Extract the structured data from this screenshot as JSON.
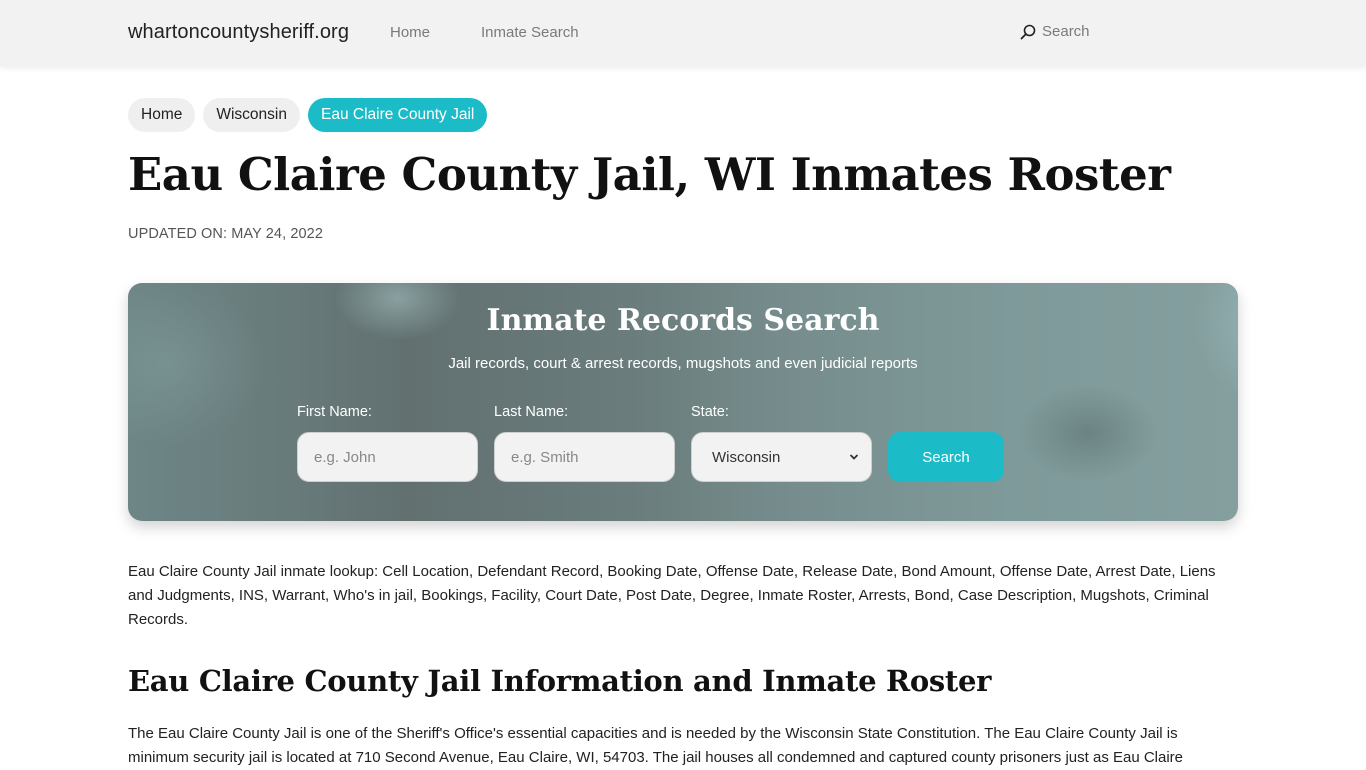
{
  "navbar": {
    "brand": "whartoncountysheriff.org",
    "links": [
      {
        "label": "Home"
      },
      {
        "label": "Inmate Search"
      }
    ],
    "search_label": "Search",
    "search_icon": "search-icon"
  },
  "breadcrumb": [
    {
      "label": "Home",
      "active": false
    },
    {
      "label": "Wisconsin",
      "active": false
    },
    {
      "label": "Eau Claire County Jail",
      "active": true
    }
  ],
  "page": {
    "title": "Eau Claire County Jail, WI Inmates Roster",
    "updated": "UPDATED ON: MAY 24, 2022"
  },
  "search_card": {
    "title": "Inmate Records Search",
    "subtitle": "Jail records, court & arrest records, mugshots and even judicial reports",
    "first_name": {
      "label": "First Name:",
      "placeholder": "e.g. John",
      "value": ""
    },
    "last_name": {
      "label": "Last Name:",
      "placeholder": "e.g. Smith",
      "value": ""
    },
    "state": {
      "label": "State:",
      "selected": "Wisconsin"
    },
    "button_label": "Search"
  },
  "content": {
    "intro": "Eau Claire County Jail inmate lookup: Cell Location, Defendant Record, Booking Date, Offense Date, Release Date, Bond Amount, Offense Date, Arrest Date, Liens and Judgments, INS, Warrant, Who's in jail, Bookings, Facility, Court Date, Post Date, Degree, Inmate Roster, Arrests, Bond, Case Description, Mugshots, Criminal Records.",
    "section_title": "Eau Claire County Jail Information and Inmate Roster",
    "paragraph": "The Eau Claire County Jail is one of the Sheriff's Office's essential capacities and is needed by the Wisconsin State Constitution. The Eau Claire County Jail is minimum security jail is located at 710 Second Avenue, Eau Claire, WI, 54703. The jail houses all condemned and captured county prisoners just as Eau Claire"
  },
  "colors": {
    "accent": "#1bbcc7",
    "navbar_bg": "#f2f2f2",
    "crumb_bg": "#efefef"
  }
}
